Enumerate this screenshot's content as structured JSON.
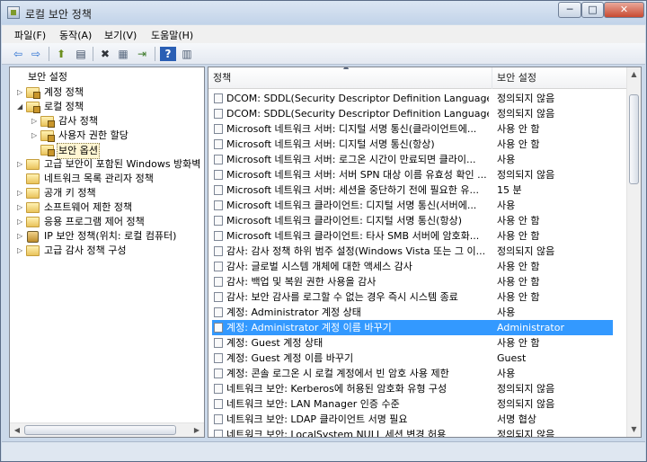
{
  "window": {
    "title": "로컬 보안 정책",
    "minimize": "─",
    "maximize": "□",
    "close": "✕"
  },
  "menu": [
    {
      "label": "파일(F)"
    },
    {
      "label": "동작(A)"
    },
    {
      "label": "보기(V)"
    },
    {
      "label": "도움말(H)"
    }
  ],
  "toolbar": [
    {
      "icon": "back-arrow-icon",
      "glyph": "⇦"
    },
    {
      "icon": "forward-arrow-icon",
      "glyph": "⇨"
    },
    {
      "icon": "up-folder-icon",
      "glyph": "⬆"
    },
    {
      "icon": "show-hide-tree-icon",
      "glyph": "▤"
    },
    {
      "icon": "delete-icon",
      "glyph": "✖"
    },
    {
      "icon": "properties-icon",
      "glyph": "▦"
    },
    {
      "icon": "export-list-icon",
      "glyph": "⇥"
    },
    {
      "icon": "help-icon",
      "glyph": "?"
    },
    {
      "icon": "help-topics-icon",
      "glyph": "▥"
    }
  ],
  "tree": [
    {
      "label": "보안 설정",
      "icon": "none",
      "toggle": "",
      "selected": false
    },
    {
      "label": "계정 정책",
      "icon": "folder",
      "toggle": "▷",
      "selected": false
    },
    {
      "label": "로컬 정책",
      "icon": "folder",
      "toggle": "◢",
      "selected": false
    },
    {
      "label": "감사 정책",
      "icon": "folder",
      "toggle": "▷",
      "selected": false
    },
    {
      "label": "사용자 권한 할당",
      "icon": "folder",
      "toggle": "▷",
      "selected": false
    },
    {
      "label": "보안 옵션",
      "icon": "folder",
      "toggle": "",
      "selected": true
    },
    {
      "label": "고급 보안이 포함된 Windows 방화벽",
      "icon": "folder-plain",
      "toggle": "▷",
      "selected": false
    },
    {
      "label": "네트워크 목록 관리자 정책",
      "icon": "folder-plain",
      "toggle": "",
      "selected": false
    },
    {
      "label": "공개 키 정책",
      "icon": "folder-plain",
      "toggle": "▷",
      "selected": false
    },
    {
      "label": "소프트웨어 제한 정책",
      "icon": "folder-plain",
      "toggle": "▷",
      "selected": false
    },
    {
      "label": "응용 프로그램 제어 정책",
      "icon": "folder-plain",
      "toggle": "▷",
      "selected": false
    },
    {
      "label": "IP 보안 정책(위치: 로컬 컴퓨터)",
      "icon": "shield",
      "toggle": "▷",
      "selected": false
    },
    {
      "label": "고급 감사 정책 구성",
      "icon": "folder-plain",
      "toggle": "▷",
      "selected": false
    }
  ],
  "columns": {
    "policy": "정책",
    "setting": "보안 설정"
  },
  "rows": [
    {
      "name": "DCOM: SDDL(Security Descriptor Definition Language) 구...",
      "value": "정의되지 않음",
      "selected": false
    },
    {
      "name": "DCOM: SDDL(Security Descriptor Definition Language) 구...",
      "value": "정의되지 않음",
      "selected": false
    },
    {
      "name": "Microsoft 네트워크 서버: 디지털 서명 통신(클라이언트에...",
      "value": "사용 안 함",
      "selected": false
    },
    {
      "name": "Microsoft 네트워크 서버: 디지털 서명 통신(항상)",
      "value": "사용 안 함",
      "selected": false
    },
    {
      "name": "Microsoft 네트워크 서버: 로그온 시간이 만료되면 클라이...",
      "value": "사용",
      "selected": false
    },
    {
      "name": "Microsoft 네트워크 서버: 서버 SPN 대상 이름 유효성 확인 ...",
      "value": "정의되지 않음",
      "selected": false
    },
    {
      "name": "Microsoft 네트워크 서버: 세션을 중단하기 전에 필요한 유...",
      "value": "15 분",
      "selected": false
    },
    {
      "name": "Microsoft 네트워크 클라이언트: 디지털 서명 통신(서버에...",
      "value": "사용",
      "selected": false
    },
    {
      "name": "Microsoft 네트워크 클라이언트: 디지털 서명 통신(항상)",
      "value": "사용 안 함",
      "selected": false
    },
    {
      "name": "Microsoft 네트워크 클라이언트: 타사 SMB 서버에 암호화...",
      "value": "사용 안 함",
      "selected": false
    },
    {
      "name": "감사: 감사 정책 하위 범주 설정(Windows Vista 또는 그 이...",
      "value": "정의되지 않음",
      "selected": false
    },
    {
      "name": "감사: 글로벌 시스템 개체에 대한 액세스 감사",
      "value": "사용 안 함",
      "selected": false
    },
    {
      "name": "감사: 백업 및 복원 권한 사용을 감사",
      "value": "사용 안 함",
      "selected": false
    },
    {
      "name": "감사: 보안 감사를 로그할 수 없는 경우 즉시 시스템 종료",
      "value": "사용 안 함",
      "selected": false
    },
    {
      "name": "계정: Administrator 계정 상태",
      "value": "사용",
      "selected": false
    },
    {
      "name": "계정: Administrator 계정 이름 바꾸기",
      "value": "Administrator",
      "selected": true
    },
    {
      "name": "계정: Guest 계정 상태",
      "value": "사용 안 함",
      "selected": false
    },
    {
      "name": "계정: Guest 계정 이름 바꾸기",
      "value": "Guest",
      "selected": false
    },
    {
      "name": "계정: 콘솔 로그온 시 로컬 계정에서 빈 암호 사용 제한",
      "value": "사용",
      "selected": false
    },
    {
      "name": "네트워크 보안: Kerberos에 허용된 암호화 유형 구성",
      "value": "정의되지 않음",
      "selected": false
    },
    {
      "name": "네트워크 보안: LAN Manager 인증 수준",
      "value": "정의되지 않음",
      "selected": false
    },
    {
      "name": "네트워크 보안: LDAP 클라이언트 서명 필요",
      "value": "서명 협상",
      "selected": false
    },
    {
      "name": "네트워크 보안: LocalSystem NULL 세션 변경 허용",
      "value": "정의되지 않음",
      "selected": false
    }
  ],
  "scroll_glyphs": {
    "up": "▲",
    "down": "▼",
    "left": "◀",
    "right": "▶",
    "sort": "▲"
  }
}
